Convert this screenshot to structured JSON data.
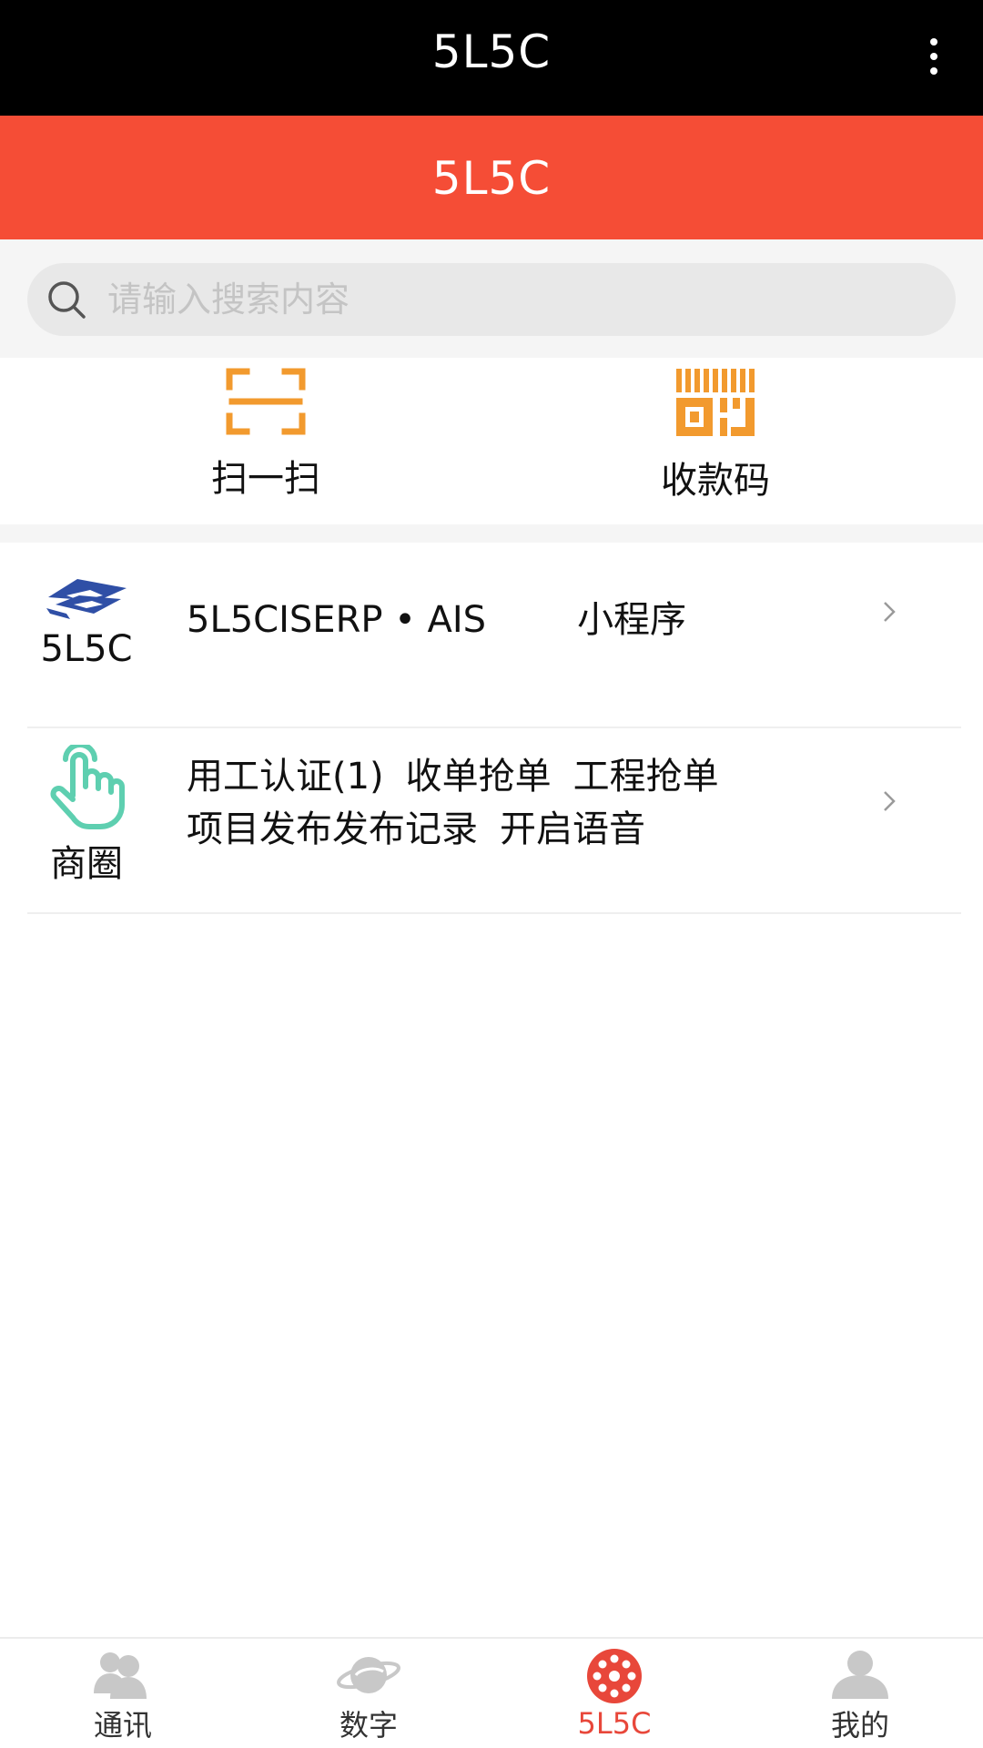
{
  "titlebar": {
    "title": "5L5C",
    "menu_icon": "more-vertical-icon"
  },
  "brandbar": {
    "title": "5L5C"
  },
  "search": {
    "placeholder": "请输入搜索内容",
    "icon": "search-icon"
  },
  "quick_actions": [
    {
      "label": "扫一扫",
      "icon": "scan-icon",
      "color": "#f29a2e"
    },
    {
      "label": "收款码",
      "icon": "payment-code-icon",
      "color": "#f29a2e"
    }
  ],
  "list": {
    "row1": {
      "caption": "5L5C",
      "text": "5L5CISERP • AIS",
      "tag": "小程序",
      "icon": "logo-icon"
    },
    "row2": {
      "caption": "商圈",
      "icon": "hand-tap-icon",
      "line1": [
        "用工认证(1)",
        "收单抢单",
        "工程抢单"
      ],
      "line2": [
        "项目发布",
        "发布记录",
        "开启语音"
      ]
    }
  },
  "tabbar": [
    {
      "label": "通讯",
      "icon": "contacts-icon",
      "active": false
    },
    {
      "label": "数字",
      "icon": "planet-icon",
      "active": false
    },
    {
      "label": "5L5C",
      "icon": "wheel-icon",
      "active": true
    },
    {
      "label": "我的",
      "icon": "profile-icon",
      "active": false
    }
  ],
  "colors": {
    "title_bar": "#000000",
    "brand": "#f54d36",
    "accent_orange": "#f29a2e",
    "active_tab": "#e8473a",
    "hand_icon": "#5ecfb0",
    "logo_blue": "#2f4fa6"
  }
}
